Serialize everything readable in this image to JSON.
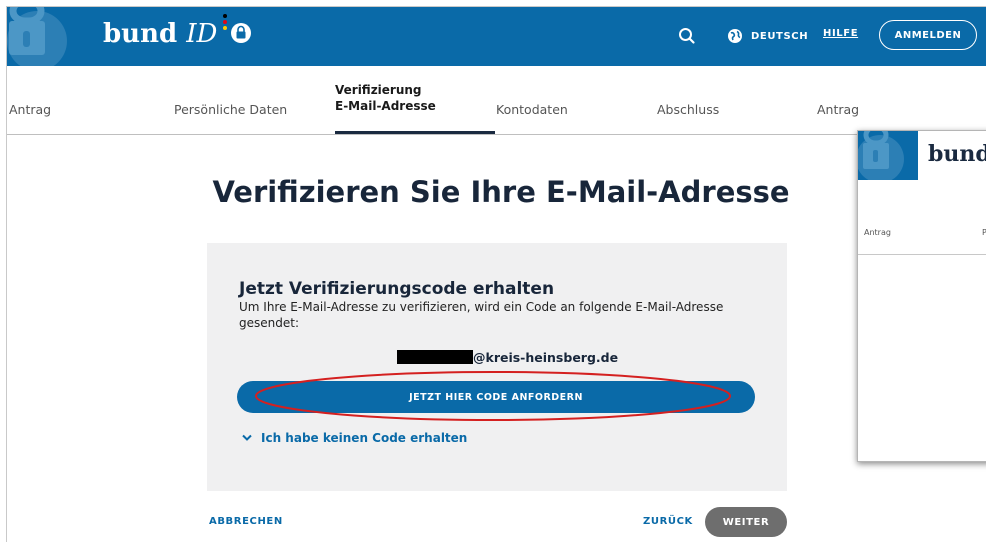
{
  "header": {
    "brand": {
      "text_main": "bund",
      "text_id": "ID"
    },
    "language": "DEUTSCH",
    "help": "HILFE",
    "login": "ANMELDEN"
  },
  "steps": [
    {
      "label": "Antrag"
    },
    {
      "label": "Persönliche Daten"
    },
    {
      "label_line1": "Verifizierung",
      "label_line2": "E-Mail-Adresse",
      "active": true
    },
    {
      "label": "Kontodaten"
    },
    {
      "label": "Abschluss"
    },
    {
      "label": "Antrag"
    }
  ],
  "main": {
    "title": "Verifizieren Sie Ihre E-Mail-Adresse",
    "card": {
      "heading": "Jetzt Verifizierungscode erhalten",
      "text": "Um Ihre E-Mail-Adresse zu verifizieren, wird ein Code an folgende E-Mail-Adresse gesendet:",
      "email_domain": "@kreis-heinsberg.de",
      "request_button": "JETZT HIER CODE ANFORDERN",
      "no_code_link": "Ich habe keinen Code erhalten"
    },
    "footer": {
      "cancel": "ABBRECHEN",
      "back": "ZURÜCK",
      "next": "WEITER"
    }
  },
  "overlay_thumbnail": {
    "brand": "bund",
    "step_first": "Antrag",
    "step_second": "P"
  },
  "colors": {
    "brand_blue": "#0a6aa8",
    "dark_navy": "#18263a",
    "highlight_ellipse": "#d42020",
    "disabled_gray": "#6e6e6e"
  }
}
